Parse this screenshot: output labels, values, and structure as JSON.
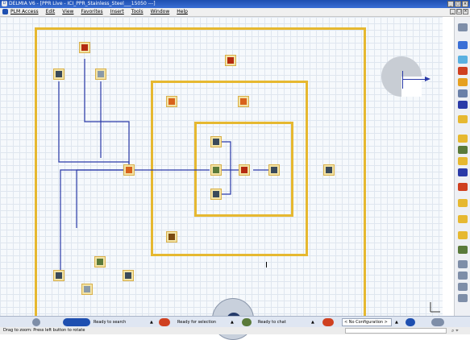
{
  "window": {
    "title": "DELMIA V6 - [PPR Live - ICI_PPR_Stainless_Steel___15050 ---]",
    "buttons": [
      "_",
      "□",
      "×"
    ]
  },
  "menu": {
    "items": [
      "PLM Access",
      "Edit",
      "View",
      "Favorites",
      "Insert",
      "Tools",
      "Window",
      "Help"
    ],
    "right_buttons": [
      "_",
      "□",
      "×"
    ]
  },
  "status": {
    "search": "Ready to search",
    "selection": "Ready for selection",
    "chat": "Ready to chat",
    "configuration": "< No Configuration >"
  },
  "hint": {
    "text": "Drag to zoom: Press left button to rotate"
  },
  "colors": {
    "frame": "#e6b830",
    "connector": "#2a3aa8",
    "title_bg": "#1e4fb0"
  },
  "icons": {
    "dial": "play-dial-icon",
    "compass": "compass-icon"
  }
}
